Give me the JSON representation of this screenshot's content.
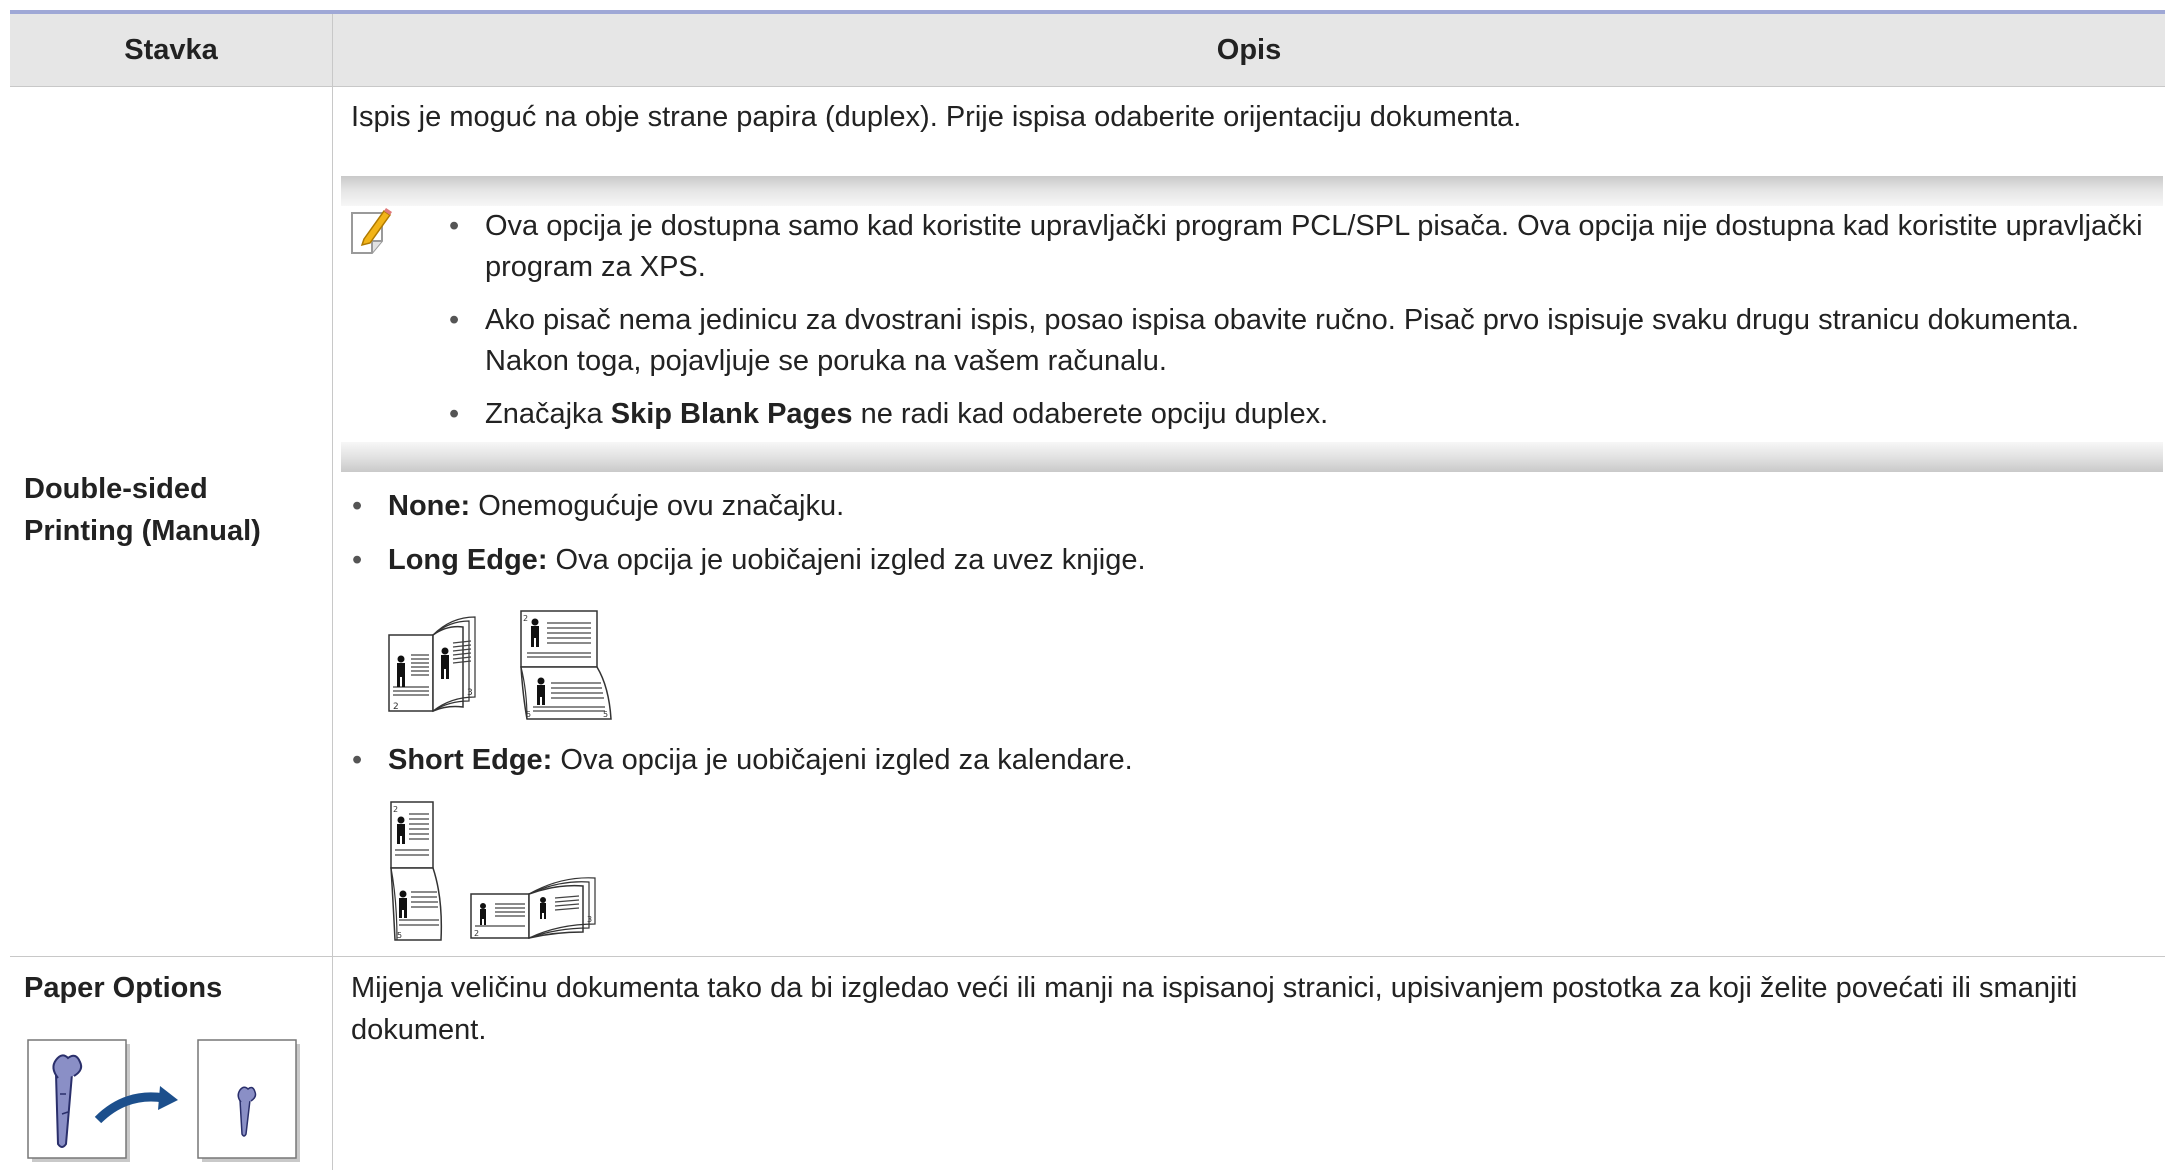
{
  "table": {
    "header": {
      "col1": "Stavka",
      "col2": "Opis"
    },
    "rows": {
      "duplex": {
        "label": "Double-sided Printing (Manual)",
        "intro": "Ispis je moguć na obje strane papira (duplex). Prije ispisa odaberite orijentaciju dokumenta.",
        "notes": {
          "n1": "Ova opcija je dostupna samo kad koristite upravljački program PCL/SPL pisača. Ova opcija nije dostupna kad koristite upravljački program za XPS.",
          "n2": "Ako pisač nema jedinicu za dvostrani ispis, posao ispisa obavite ručno. Pisač prvo ispisuje svaku drugu stranicu dokumenta. Nakon toga, pojavljuje se poruka na vašem računalu.",
          "n3_pre": "Značajka ",
          "n3_bold": "Skip Blank Pages",
          "n3_post": " ne radi kad odaberete opciju duplex."
        },
        "options": {
          "none_label": "None:",
          "none_text": " Onemogućuje ovu značajku.",
          "long_label": "Long Edge:",
          "long_text": " Ova opcija je uobičajeni izgled za uvez knjige.",
          "short_label": "Short Edge:",
          "short_text": " Ova opcija je uobičajeni izgled za kalendare."
        },
        "page_numbers": {
          "p2": "2",
          "p3": "3",
          "p5": "5"
        }
      },
      "paper": {
        "label": "Paper Options",
        "text": "Mijenja veličinu dokumenta tako da bi izgledao veći ili manji na ispisanoj stranici, upisivanjem postotka za koji želite povećati ili smanjiti dokument."
      }
    }
  },
  "icons": {
    "note": "note-pencil-icon",
    "arrow": "curved-arrow-icon",
    "figure": "person-figure-icon"
  },
  "colors": {
    "header_bg": "#e6e6e6",
    "top_rule": "#9fa8d6",
    "arrow": "#1c4f8c",
    "carrot": "#8a8fc6"
  }
}
